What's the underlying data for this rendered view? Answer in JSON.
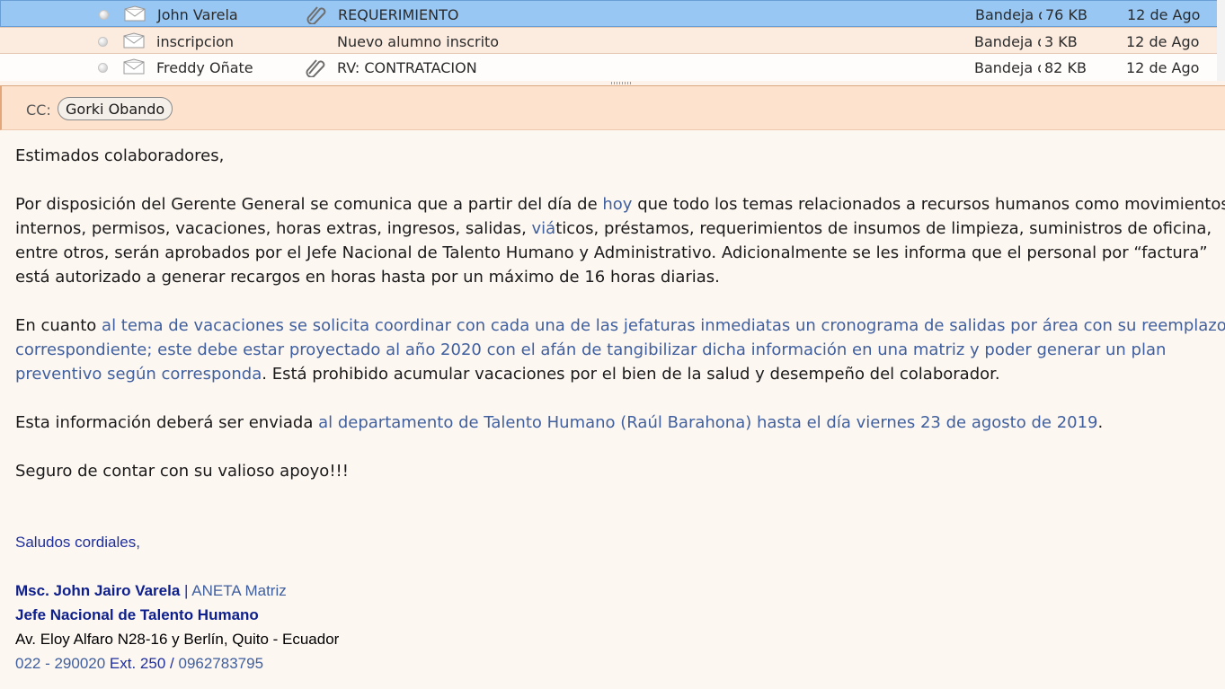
{
  "messages": [
    {
      "sender": "John Varela",
      "attachment": true,
      "subject": "REQUERIMIENTO",
      "folder": "Bandeja de entrada",
      "size": "76 KB",
      "date": "12 de Ago"
    },
    {
      "sender": "inscripcion",
      "attachment": false,
      "subject": "Nuevo alumno inscrito",
      "folder": "Bandeja de entrada",
      "size": "3 KB",
      "date": "12 de Ago"
    },
    {
      "sender": "Freddy Oñate",
      "attachment": true,
      "subject": "RV: CONTRATACION",
      "folder": "Bandeja de entrada",
      "size": "82 KB",
      "date": "12 de Ago"
    }
  ],
  "header": {
    "cc_label": "CC:",
    "cc_chip": "Gorki Obando"
  },
  "body": {
    "greeting": "Estimados colaboradores,",
    "p1_l1a": "Por disposición del Gerente General se comunica que a partir del día de ",
    "p1_l1b": "hoy",
    "p1_l1c": " que todo los temas relacionados a recursos humanos como movimientos",
    "p1_l2a": "internos, permisos, vacaciones, horas extras, ingresos, salidas, ",
    "p1_l2b": "viá",
    "p1_l2c": "ticos, préstamos, requerimientos de insumos de limpieza, suministros de oficina,",
    "p1_l3": "entre otros, serán aprobados por el Jefe Nacional de Talento Humano y Administrativo. Adicionalmente se les informa que el personal por “factura”",
    "p1_l4": "está autorizado a generar recargos en horas  hasta por un máximo de 16 horas diarias.",
    "p2_l1a": "En cuanto ",
    "p2_l1b": "al tema de vacaciones se solicita coordinar con cada una de las jefaturas inmediatas un cronograma de salidas por área con su reemplazo",
    "p2_l2": "correspondiente; este debe estar proyectado al año 2020 con el afán de tangibilizar dicha información en una matriz y poder generar un plan",
    "p2_l3a": "preventivo según corresponda",
    "p2_l3b": ". Está prohibido acumular vacaciones por el bien de la salud y desempeño del colaborador.",
    "p3a": "Esta información deberá ser enviada ",
    "p3b": "al departamento de Talento Humano (Raúl Barahona) hasta el día viernes 23 de agosto de 2019",
    "p3c": ".",
    "p4": "Seguro de contar con su valioso apoyo!!!"
  },
  "signature": {
    "closing": "Saludos cordiales,",
    "name": "Msc. John Jairo Varela",
    "sep": " | ",
    "org": "ANETA Matriz",
    "title": "Jefe Nacional de Talento Humano",
    "address": "Av. Eloy Alfaro N28-16 y Berlín, Quito - Ecuador",
    "phone1": "022 - 290020",
    "ext": " Ext. 250",
    "slash": "   /  ",
    "phone2": "0962783795"
  },
  "colors": {
    "selected_row": "#99c7f3",
    "header_bg": "#fde2cd",
    "link_blue": "#3f5f9e",
    "navy": "#1f2f9c"
  }
}
